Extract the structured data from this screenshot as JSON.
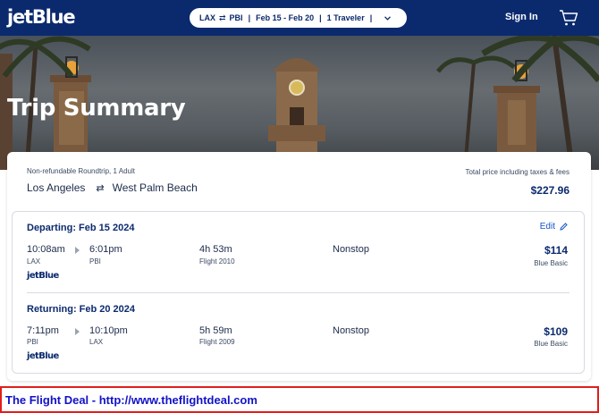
{
  "nav": {
    "logo": "jetBlue",
    "search": {
      "origin": "LAX",
      "swap_glyph": "⇄",
      "destination": "PBI",
      "dates": "Feb 15 - Feb 20",
      "travelers": "1 Traveler"
    },
    "sign_in": "Sign In",
    "cart_icon": "cart-icon"
  },
  "hero": {
    "title": "Trip Summary"
  },
  "summary": {
    "fare_type": "Non-refundable Roundtrip, 1 Adult",
    "origin_city": "Los Angeles",
    "swap_glyph": "⇄",
    "destination_city": "West Palm Beach",
    "total_label": "Total price including taxes & fees",
    "total_price": "$227.96"
  },
  "departing": {
    "title": "Departing: Feb 15 2024",
    "edit_label": "Edit",
    "depart_time": "10:08am",
    "depart_airport": "LAX",
    "arrive_time": "6:01pm",
    "arrive_airport": "PBI",
    "duration": "4h 53m",
    "flight": "Flight 2010",
    "stops": "Nonstop",
    "price": "$114",
    "fare_class": "Blue Basic",
    "airline": "jetBlue"
  },
  "returning": {
    "title": "Returning: Feb 20 2024",
    "depart_time": "7:11pm",
    "depart_airport": "PBI",
    "arrive_time": "10:10pm",
    "arrive_airport": "LAX",
    "duration": "5h 59m",
    "flight": "Flight 2009",
    "stops": "Nonstop",
    "price": "$109",
    "fare_class": "Blue Basic",
    "airline": "jetBlue"
  },
  "banner": {
    "text": "The Flight Deal - http://www.theflightdeal.com"
  },
  "colors": {
    "brand_navy": "#0b2a6e",
    "link_blue": "#1553c6",
    "banner_red": "#e11d1d",
    "banner_text": "#1212c8"
  }
}
